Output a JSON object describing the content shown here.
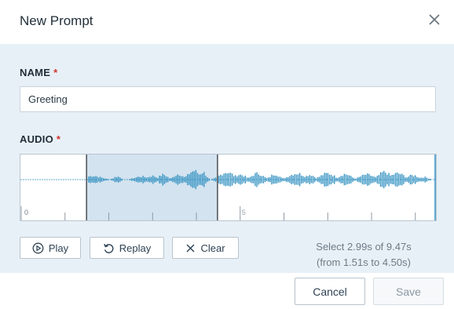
{
  "dialog": {
    "title": "New Prompt",
    "close_icon": "close-icon"
  },
  "name_field": {
    "label": "NAME",
    "required_mark": "*",
    "value": "Greeting"
  },
  "audio_field": {
    "label": "AUDIO",
    "required_mark": "*",
    "total_duration_s": 9.47,
    "selection_start_s": 1.51,
    "selection_end_s": 4.5,
    "timeline_labels": [
      "0",
      "5"
    ]
  },
  "buttons": {
    "play": "Play",
    "replay": "Replay",
    "clear": "Clear"
  },
  "selection_info": {
    "line1": "Select 2.99s of 9.47s",
    "line2": "(from 1.51s to 4.50s)"
  },
  "footer": {
    "cancel": "Cancel",
    "save": "Save"
  },
  "colors": {
    "waveform": "#2f8fc0",
    "selection_fill": "#d3e3ef",
    "required": "#d0342c",
    "panel_bg": "#e8f0f7"
  }
}
